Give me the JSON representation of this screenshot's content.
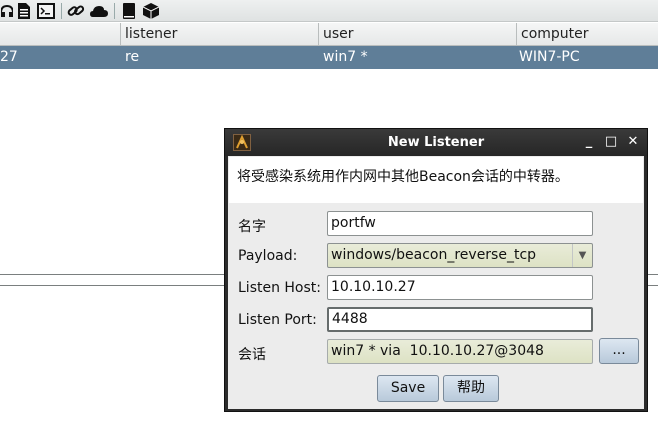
{
  "toolbar": {
    "icons": [
      "headset-icon",
      "document-icon",
      "terminal-icon",
      "link-icon",
      "cloud-icon",
      "notebook-icon",
      "package-icon"
    ]
  },
  "table": {
    "columns": [
      "listener",
      "user",
      "computer"
    ],
    "selected_row": {
      "internal": "27",
      "listener": "re",
      "user": "win7 *",
      "computer": "WIN7-PC"
    }
  },
  "dialog": {
    "title": "New Listener",
    "description": "将受感染系统用作内网中其他Beacon会话的中转器。",
    "fields": {
      "name_label": "名字",
      "name_value": "portfw",
      "payload_label": "Payload:",
      "payload_value": "windows/beacon_reverse_tcp",
      "host_label": "Listen Host:",
      "host_value": "10.10.10.27",
      "port_label": "Listen Port:",
      "port_value": "4488",
      "session_label": "会话",
      "session_value": "win7 * via  10.10.10.27@3048"
    },
    "buttons": {
      "browse": "...",
      "save": "Save",
      "help": "帮助"
    },
    "window_controls": {
      "minimize": "_",
      "maximize": "□",
      "close": "✕"
    }
  }
}
